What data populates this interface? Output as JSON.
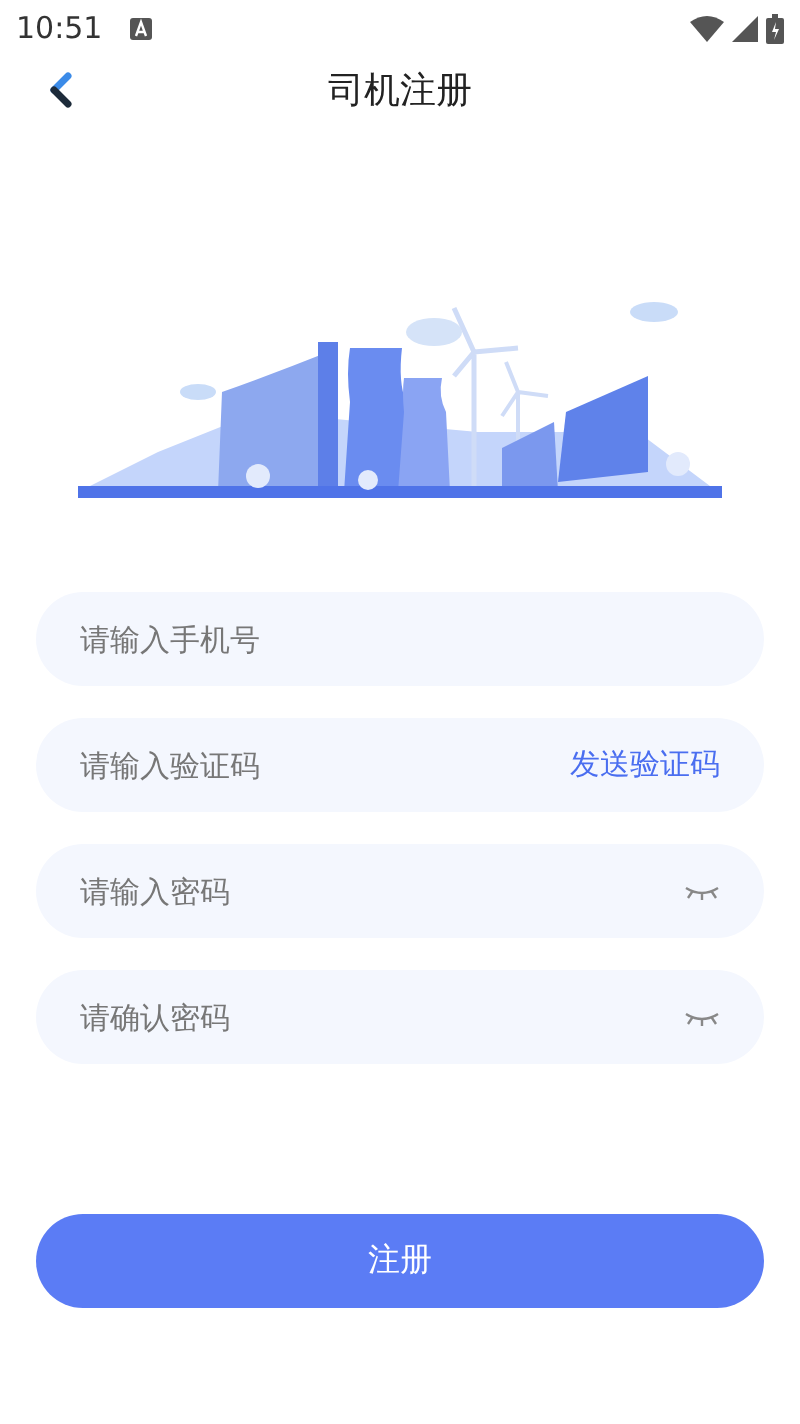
{
  "status_bar": {
    "time": "10:51"
  },
  "header": {
    "title": "司机注册"
  },
  "fields": [
    {
      "kind": "plain",
      "placeholder": "请输入手机号"
    },
    {
      "kind": "code",
      "placeholder": "请输入验证码",
      "action": "发送验证码"
    },
    {
      "kind": "password",
      "placeholder": "请输入密码"
    },
    {
      "kind": "password",
      "placeholder": "请确认密码"
    }
  ],
  "submit": {
    "label": "注册"
  }
}
